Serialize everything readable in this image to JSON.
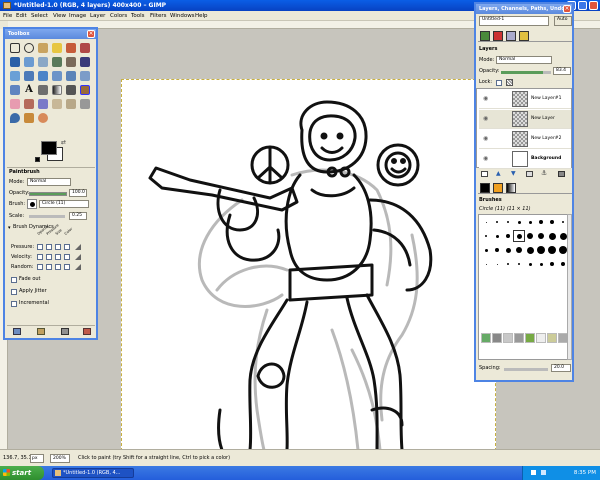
{
  "window": {
    "title": "*Untitled-1.0 (RGB, 4 layers) 400x400 – GIMP"
  },
  "menu": [
    "File",
    "Edit",
    "Select",
    "View",
    "Image",
    "Layer",
    "Colors",
    "Tools",
    "Filters",
    "Windows",
    "Help"
  ],
  "toolbox": {
    "title": "Toolbox",
    "options_title": "Paintbrush",
    "mode_label": "Mode:",
    "mode_value": "Normal",
    "opacity_label": "Opacity:",
    "opacity_value": "100.0",
    "brush_label": "Brush:",
    "brush_value": "Circle (11)",
    "scale_label": "Scale:",
    "scale_value": "0.25",
    "brush_dynamics_label": "Brush Dynamics",
    "dyn_cols": [
      "Opacity",
      "Pressure",
      "Size",
      "Color"
    ],
    "dyn_rows": [
      "Pressure:",
      "Velocity:",
      "Random:"
    ],
    "fade_out_label": "Fade out",
    "apply_jitter_label": "Apply Jitter",
    "incremental_label": "Incremental"
  },
  "layers_dock": {
    "title": "Layers, Channels, Paths, Undo -",
    "image_select": "Untitled-1",
    "auto_label": "Auto",
    "section": "Layers",
    "mode_label": "Mode:",
    "mode_value": "Normal",
    "opacity_label": "Opacity:",
    "opacity_value": "83.4",
    "opacity_fraction": 0.834,
    "lock_label": "Lock:",
    "layers": [
      {
        "name": "New Layer#1"
      },
      {
        "name": "New Layer"
      },
      {
        "name": "New Layer#2"
      },
      {
        "name": "Background"
      }
    ],
    "brushes_section": "Brushes",
    "brush_name": "Circle (11) (11 × 11)",
    "spacing_label": "Spacing:",
    "spacing_value": "20.0"
  },
  "status": {
    "coords": "136.7, 35.1",
    "unit": "px",
    "zoom": "200%",
    "message": "Click to paint (try Shift for a straight line, Ctrl to pick a color)"
  },
  "taskbar": {
    "start_label": "start",
    "task_label": "*Untitled-1.0 (RGB, 4...",
    "clock": "8:35 PM"
  },
  "colors": {
    "titlebar": "#0842c2",
    "dock_border": "#4e84e4",
    "canvas_bg": "#c7c5bd",
    "fg_color": "#000000",
    "bg_color": "#ffffff"
  }
}
